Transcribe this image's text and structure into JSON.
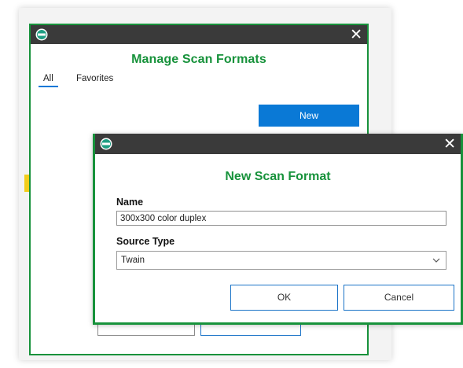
{
  "back_window": {
    "title": "Manage Scan Formats",
    "tabs": [
      {
        "label": "All",
        "active": true
      },
      {
        "label": "Favorites",
        "active": false
      }
    ],
    "new_button": "New",
    "close_glyph": "✕"
  },
  "dialog": {
    "title": "New Scan Format",
    "close_glyph": "✕",
    "name_label": "Name",
    "name_value": "300x300 color duplex",
    "source_type_label": "Source Type",
    "source_type_value": "Twain",
    "ok_label": "OK",
    "cancel_label": "Cancel"
  },
  "icons": {
    "app_icon": "app-logo-icon",
    "close_icon": "close-icon",
    "dropdown_icon": "chevron-down-icon"
  },
  "colors": {
    "accent_green": "#17923b",
    "titlebar": "#3a3a3a",
    "primary_blue": "#0a79d6",
    "button_border": "#1a73c7",
    "marker_yellow": "#f2cd1a"
  }
}
